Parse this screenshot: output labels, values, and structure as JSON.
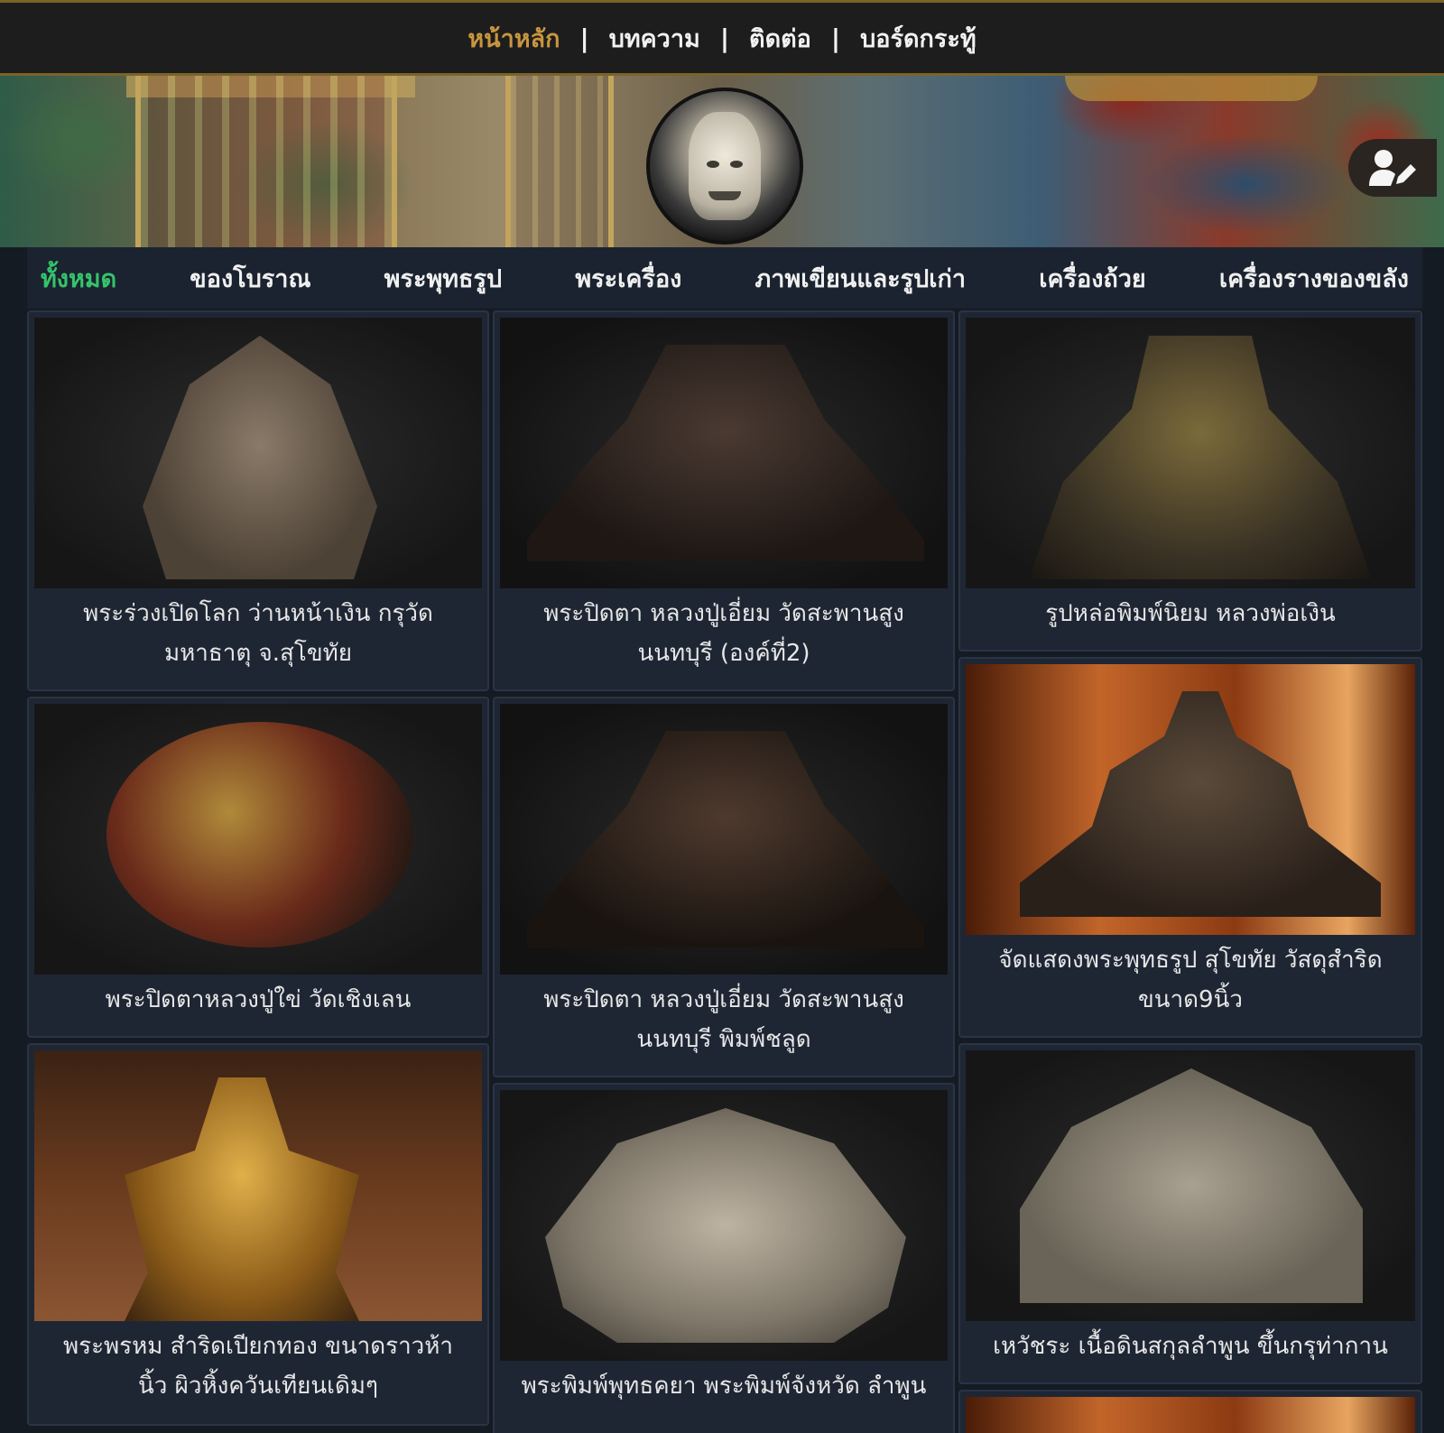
{
  "topnav": {
    "items": [
      {
        "label": "หน้าหลัก",
        "active": true
      },
      {
        "label": "บทความ",
        "active": false
      },
      {
        "label": "ติดต่อ",
        "active": false
      },
      {
        "label": "บอร์ดกระทู้",
        "active": false
      }
    ],
    "separator": "|"
  },
  "banner": {
    "icons": {
      "logo": "kala-face-logo",
      "user": "user-edit-icon"
    }
  },
  "categories": [
    {
      "label": "ทั้งหมด",
      "active": true
    },
    {
      "label": "ของโบราณ",
      "active": false
    },
    {
      "label": "พระพุทธรูป",
      "active": false
    },
    {
      "label": "พระเครื่อง",
      "active": false
    },
    {
      "label": "ภาพเขียนและรูปเก่า",
      "active": false
    },
    {
      "label": "เครื่องถ้วย",
      "active": false
    },
    {
      "label": "เครื่องรางของขลัง",
      "active": false
    }
  ],
  "items": [
    {
      "caption": "พระร่วงเปิดโลก ว่านหน้าเงิน กรุวัด มหาธาตุ จ.สุโขทัย"
    },
    {
      "caption": "พระปิดตา หลวงปู่เอี่ยม วัดสะพานสูง นนทบุรี (องค์ที่2)"
    },
    {
      "caption": "รูปหล่อพิมพ์นิยม หลวงพ่อเงิน"
    },
    {
      "caption": "พระปิดตาหลวงปู่ใข่ วัดเชิงเลน"
    },
    {
      "caption": "พระปิดตา หลวงปู่เอี่ยม วัดสะพานสูง นนทบุรี พิมพ์ชลูด"
    },
    {
      "caption": "จัดแสดงพระพุทธรูป สุโขทัย วัสดุสำริด ขนาด9นิ้ว"
    },
    {
      "caption": "พระพรหม สำริดเปียกทอง ขนาดราวห้า นิ้ว ผิวหิ้งควันเทียนเดิมๆ"
    },
    {
      "caption": "พระพิมพ์พุทธคยา พระพิมพ์จังหวัด ลำพูน"
    },
    {
      "caption": "เหวัชระ เนื้อดินสกุลลำพูน ขึ้นกรุท่ากาน"
    }
  ],
  "colors": {
    "accent_gold": "#c8963e",
    "active_green": "#35c46a",
    "card_bg": "#1e2634"
  }
}
